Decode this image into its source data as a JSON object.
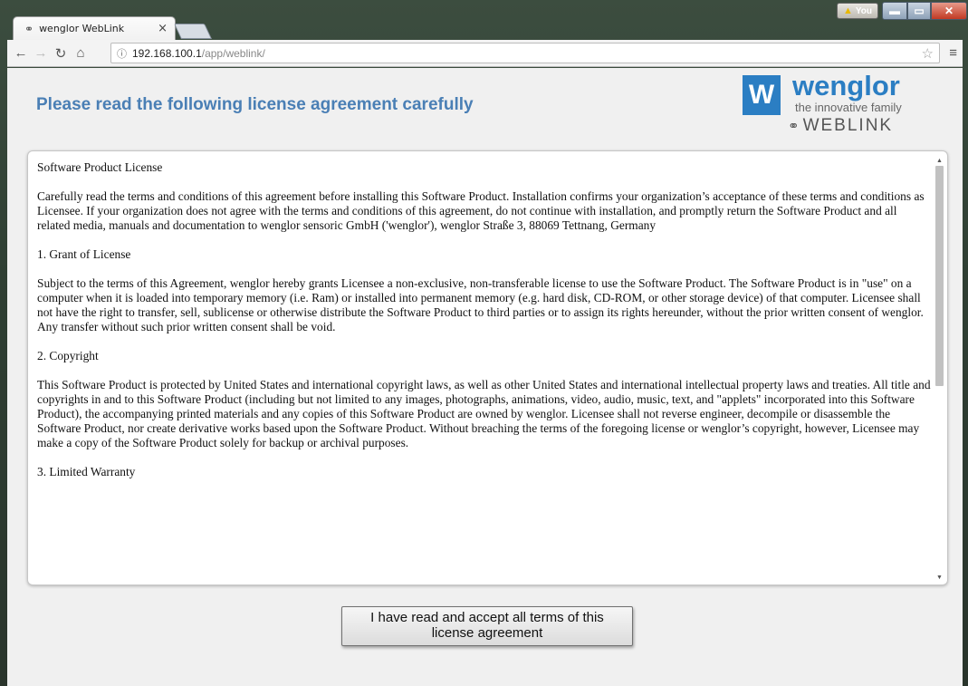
{
  "browser": {
    "tab_title": "wenglor WebLink",
    "tab_close": "×",
    "user_badge": "You",
    "url_host": "192.168.100.1",
    "url_path": "/app/weblink/"
  },
  "icons": {
    "favicon": "link-icon",
    "back": "back-arrow-icon",
    "forward": "forward-arrow-icon",
    "reload": "reload-icon",
    "home": "home-icon",
    "info": "info-icon",
    "star": "star-icon",
    "menu": "hamburger-menu-icon"
  },
  "page": {
    "heading": "Please read the following license agreement carefully",
    "logo": {
      "name": "wenglor",
      "tagline": "the innovative family",
      "product": "WEBLINK"
    },
    "license_paragraphs": [
      "Software Product License",
      "Carefully read the terms and conditions of this agreement before installing this Software Product. Installation confirms your organization’s acceptance of these terms and conditions as Licensee. If your organization does not agree with the terms and conditions of this agreement, do not continue with installation, and promptly return the Software Product and all related media, manuals and documentation to wenglor sensoric GmbH ('wenglor'), wenglor Straße 3, 88069 Tettnang, Germany",
      "1. Grant of License",
      "Subject to the terms of this Agreement, wenglor hereby grants Licensee a non-exclusive, non-transferable license to use the Software Product. The Software Product is in \"use\" on a computer when it is loaded into temporary memory (i.e. Ram) or installed into permanent memory (e.g. hard disk, CD-ROM, or other storage device) of that computer. Licensee shall not have the right to transfer, sell, sublicense or otherwise distribute the Software Product to third parties or to assign its rights hereunder, without the prior written consent of wenglor. Any transfer without such prior written consent shall be void.",
      "2. Copyright",
      "This Software Product is protected by United States and international copyright laws, as well as other United States and international intellectual property laws and treaties. All title and copyrights in and to this Software Product (including but not limited to any images, photographs, animations, video, audio, music, text, and \"applets\" incorporated into this Software Product), the accompanying printed materials and any copies of this Software Product are owned by wenglor. Licensee shall not reverse engineer, decompile or disassemble the Software Product, nor create derivative works based upon the Software Product. Without breaching the terms of the foregoing license or wenglor’s copyright, however, Licensee may make a copy of the Software Product solely for backup or archival purposes.",
      "3. Limited Warranty"
    ],
    "accept_button": "I have read and accept all terms of this license agreement"
  },
  "colors": {
    "heading": "#4a7fb5",
    "brand": "#2b7ec3"
  }
}
